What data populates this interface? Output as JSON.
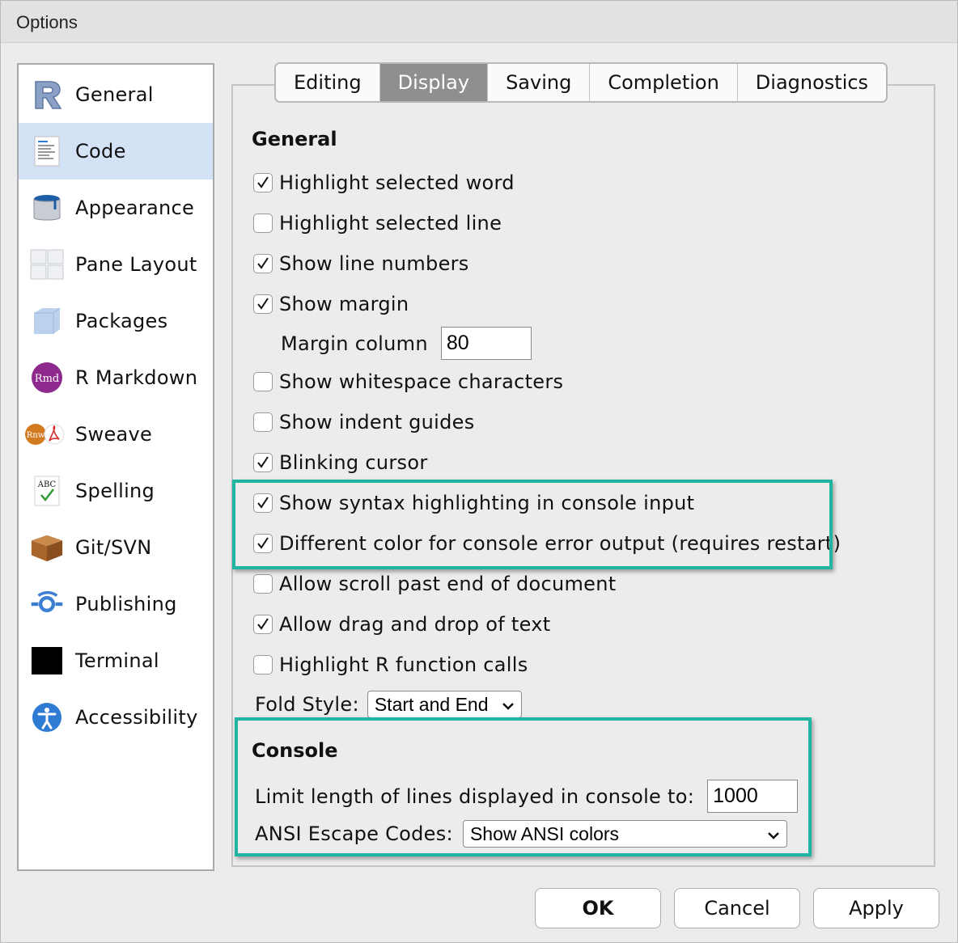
{
  "window": {
    "title": "Options"
  },
  "sidebar": {
    "items": [
      {
        "label": "General",
        "icon": "r-logo-icon"
      },
      {
        "label": "Code",
        "icon": "code-document-icon",
        "active": true
      },
      {
        "label": "Appearance",
        "icon": "paint-bucket-icon"
      },
      {
        "label": "Pane Layout",
        "icon": "pane-grid-icon"
      },
      {
        "label": "Packages",
        "icon": "package-box-icon"
      },
      {
        "label": "R Markdown",
        "icon": "rmd-icon",
        "icon_text": "Rmd"
      },
      {
        "label": "Sweave",
        "icon": "sweave-rnw-icon",
        "icon_text": "Rnw"
      },
      {
        "label": "Spelling",
        "icon": "spelling-abc-icon",
        "icon_text": "ABC"
      },
      {
        "label": "Git/SVN",
        "icon": "git-box-icon"
      },
      {
        "label": "Publishing",
        "icon": "publishing-icon"
      },
      {
        "label": "Terminal",
        "icon": "terminal-icon"
      },
      {
        "label": "Accessibility",
        "icon": "accessibility-icon"
      }
    ]
  },
  "tabs": [
    {
      "label": "Editing"
    },
    {
      "label": "Display",
      "active": true
    },
    {
      "label": "Saving"
    },
    {
      "label": "Completion"
    },
    {
      "label": "Diagnostics"
    }
  ],
  "general": {
    "title": "General",
    "options": [
      {
        "label": "Highlight selected word",
        "checked": true
      },
      {
        "label": "Highlight selected line",
        "checked": false
      },
      {
        "label": "Show line numbers",
        "checked": true
      },
      {
        "label": "Show margin",
        "checked": true
      },
      {
        "label": "Show whitespace characters",
        "checked": false
      },
      {
        "label": "Show indent guides",
        "checked": false
      },
      {
        "label": "Blinking cursor",
        "checked": true
      },
      {
        "label": "Show syntax highlighting in console input",
        "checked": true
      },
      {
        "label": "Different color for console error output (requires restart)",
        "checked": true
      },
      {
        "label": "Allow scroll past end of document",
        "checked": false
      },
      {
        "label": "Allow drag and drop of text",
        "checked": true
      },
      {
        "label": "Highlight R function calls",
        "checked": false
      }
    ],
    "margin_column": {
      "label": "Margin column",
      "value": "80"
    },
    "fold_style": {
      "label": "Fold Style:",
      "value": "Start and End"
    }
  },
  "console": {
    "title": "Console",
    "limit_lines": {
      "label": "Limit length of lines displayed in console to:",
      "value": "1000"
    },
    "ansi": {
      "label": "ANSI Escape Codes:",
      "value": "Show ANSI colors"
    }
  },
  "buttons": {
    "ok": "OK",
    "cancel": "Cancel",
    "apply": "Apply"
  },
  "colors": {
    "highlight": "#1fb5a0",
    "active_sidebar": "#d3e3f5",
    "active_tab": "#8f8f8f"
  }
}
